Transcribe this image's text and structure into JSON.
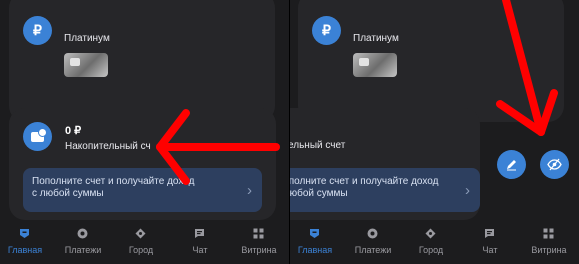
{
  "account_card": {
    "label": "Платинум"
  },
  "savings_card": {
    "amount": "0 ₽",
    "left_label": "Накопительный сч",
    "right_label": "опительный счет",
    "banner_line1": "Пополните счет и получайте доход",
    "banner_line2": "с любой суммы"
  },
  "tabs": [
    {
      "label": "Главная",
      "icon": "home-icon",
      "active": true
    },
    {
      "label": "Платежи",
      "icon": "payments-icon"
    },
    {
      "label": "Город",
      "icon": "city-icon"
    },
    {
      "label": "Чат",
      "icon": "chat-icon"
    },
    {
      "label": "Витрина",
      "icon": "showcase-icon"
    }
  ],
  "actions": {
    "edit": "edit-icon",
    "hide": "eye-off-icon"
  },
  "colors": {
    "accent": "#3b82d6",
    "annotation": "#ff0000",
    "background": "#1c1c1e",
    "card": "#262629",
    "banner": "#2d3f5f"
  }
}
